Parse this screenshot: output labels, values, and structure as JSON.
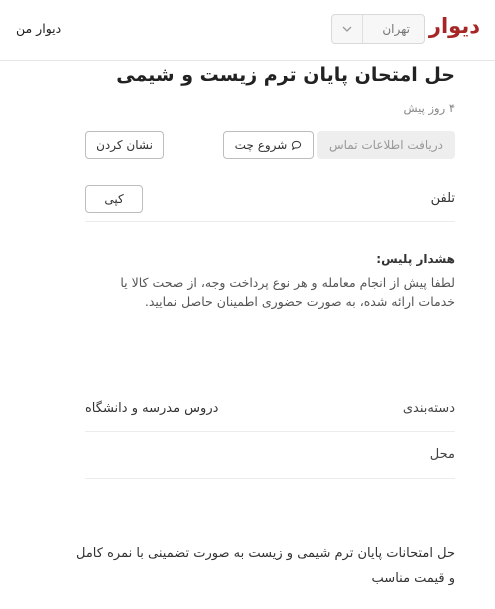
{
  "header": {
    "logo": "دیوار",
    "city": "تهران",
    "my_divar": "دیوار من"
  },
  "post": {
    "title": "حل امتحان پایان ترم زیست و شیمی",
    "time": "۴ روز پیش"
  },
  "actions": {
    "contact": "دریافت اطلاعات تماس",
    "chat": "شروع چت",
    "mark": "نشان کردن"
  },
  "phone": {
    "label": "تلفن",
    "copy": "کپی"
  },
  "warning": {
    "title": "هشدار پلیس:",
    "body": "لطفا پیش از انجام معامله و هر نوع پرداخت وجه، از صحت کالا یا خدمات ارائه شده، به صورت حضوری اطمینان حاصل نمایید."
  },
  "details": [
    {
      "label": "دسته‌بندی",
      "value": "دروس مدرسه و دانشگاه"
    },
    {
      "label": "محل",
      "value": ""
    }
  ],
  "description": "حل امتحانات پایان ترم شیمی و زیست به صورت تضمینی با نمره کامل و قیمت مناسب",
  "colors": {
    "brand": "#a62626",
    "divider": "#ececec"
  },
  "icons": {
    "chat": "chat-bubble-icon",
    "chevron": "chevron-down-icon"
  }
}
